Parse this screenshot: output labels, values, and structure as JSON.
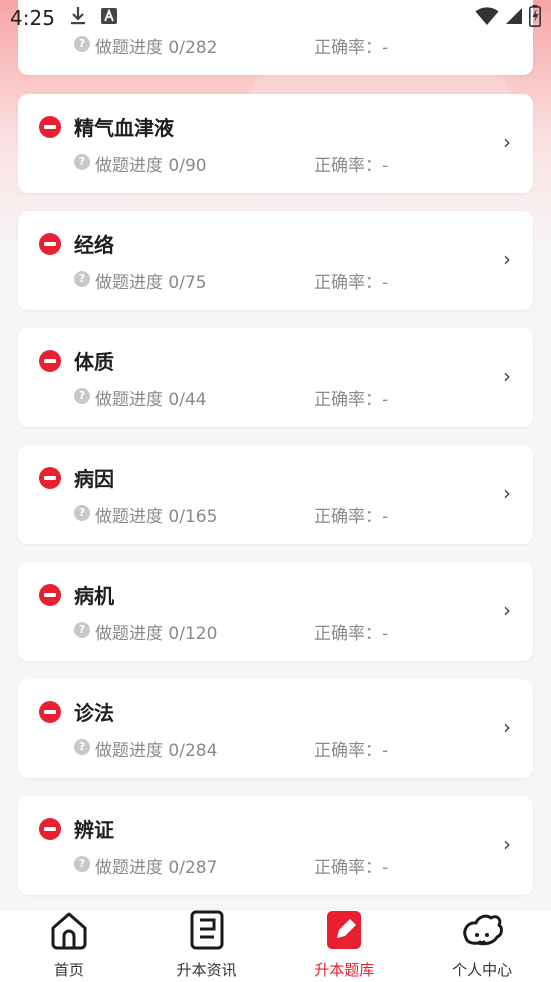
{
  "status_bar": {
    "time": "4:25"
  },
  "items": [
    {
      "title": "",
      "progress": "做题进度 0/282",
      "accuracy": "正确率：-"
    },
    {
      "title": "精气血津液",
      "progress": "做题进度 0/90",
      "accuracy": "正确率：-"
    },
    {
      "title": "经络",
      "progress": "做题进度 0/75",
      "accuracy": "正确率：-"
    },
    {
      "title": "体质",
      "progress": "做题进度 0/44",
      "accuracy": "正确率：-"
    },
    {
      "title": "病因",
      "progress": "做题进度 0/165",
      "accuracy": "正确率：-"
    },
    {
      "title": "病机",
      "progress": "做题进度 0/120",
      "accuracy": "正确率：-"
    },
    {
      "title": "诊法",
      "progress": "做题进度 0/284",
      "accuracy": "正确率：-"
    },
    {
      "title": "辨证",
      "progress": "做题进度 0/287",
      "accuracy": "正确率：-"
    }
  ],
  "item_icons": {
    "status": "minus-circle-icon",
    "help": "question-icon",
    "open": "chevron-right-icon",
    "chevron": "›",
    "help_glyph": "?"
  },
  "tabs": [
    {
      "label": "首页",
      "icon": "home-icon"
    },
    {
      "label": "升本资讯",
      "icon": "news-icon"
    },
    {
      "label": "升本题库",
      "icon": "question-bank-icon",
      "active": true
    },
    {
      "label": "个人中心",
      "icon": "profile-icon"
    }
  ],
  "colors": {
    "accent": "#e8202f",
    "text_secondary": "#8a8a8a"
  }
}
